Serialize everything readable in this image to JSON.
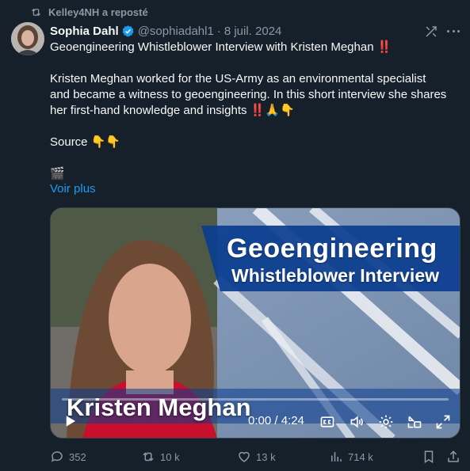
{
  "repost": {
    "text": "Kelley4NH a reposté",
    "icon": "repost-icon"
  },
  "author": {
    "name": "Sophia Dahl",
    "handle": "@sophiadahl1",
    "separator": "·",
    "date": "8 juil. 2024",
    "verified": true,
    "verified_color": "#1d9bf0"
  },
  "tweet": {
    "lines": [
      "Geoengineering Whistleblower Interview with Kristen Meghan ‼️",
      "",
      "Kristen Meghan worked for the US-Army as an environmental specialist",
      "and became a witness to geoengineering. In this short interview she shares",
      "her first-hand knowledge and insights ‼️🙏👇",
      "",
      "Source 👇👇",
      "",
      "🎬"
    ],
    "show_more": "Voir plus"
  },
  "media": {
    "title": "Geoengineering",
    "subtitle": "Whistleblower Interview",
    "caption_name": "Kristen Meghan",
    "time": "0:00 / 4:24",
    "progress": 0
  },
  "actions": {
    "replies": "352",
    "reposts": "10 k",
    "likes": "13 k",
    "views": "714 k"
  },
  "colors": {
    "background": "#15202b",
    "text": "#f7f9f9",
    "muted": "#8b98a5",
    "link": "#1d9bf0",
    "title_band": "#0a3d8f"
  }
}
